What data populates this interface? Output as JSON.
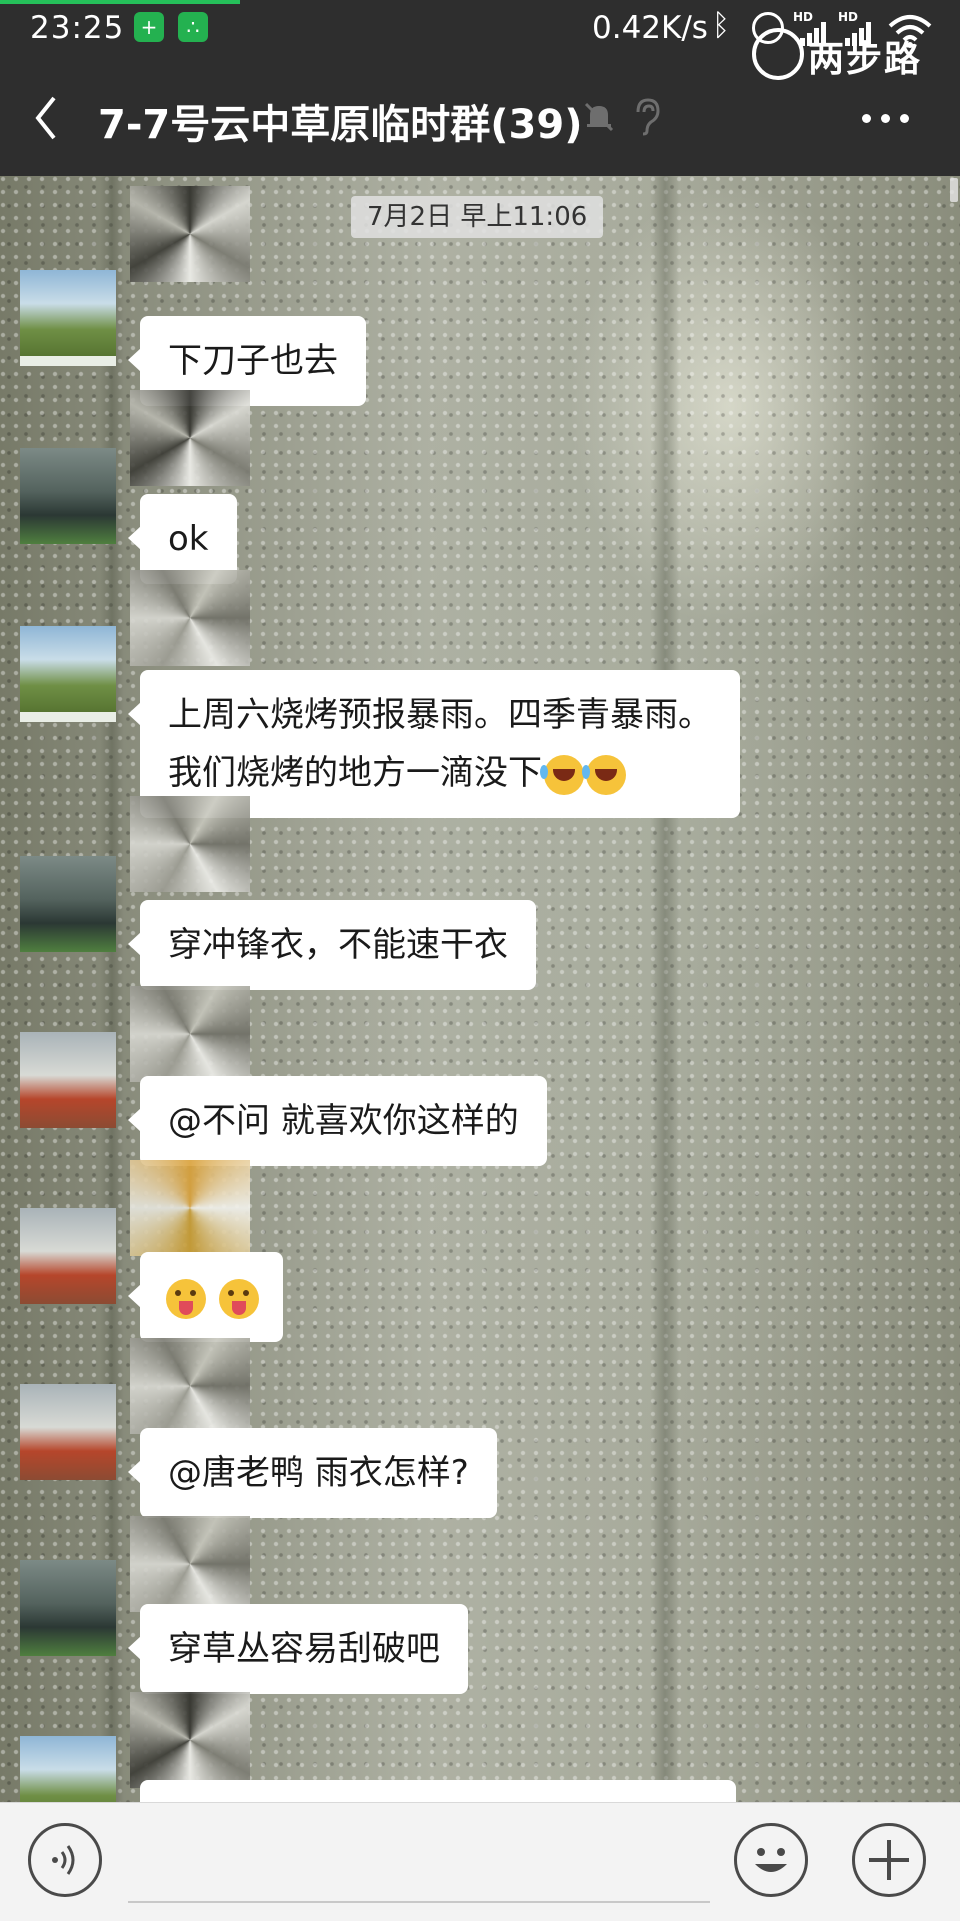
{
  "status_bar": {
    "time": "23:25",
    "net_speed": "0.42K/s",
    "bt_icon": "bluetooth-icon",
    "hd1": "HD",
    "hd2": "HD",
    "progress_color": "#25c05a"
  },
  "watermark": {
    "text": "两步路"
  },
  "header": {
    "title": "7-7号云中草原临时群(39)",
    "back_icon": "chevron-left-icon",
    "mute_icon": "bell-mute-icon",
    "ear_icon": "earpiece-icon",
    "more_icon": "more-dots-icon",
    "bg_color": "#2e2e2e"
  },
  "chat": {
    "date_label": "7月2日 早上11:06",
    "messages": [
      {
        "avatar": "mountain-avatar",
        "text": "下刀子也去"
      },
      {
        "avatar": "diver-avatar",
        "text": "ok"
      },
      {
        "avatar": "mountain-avatar",
        "line1": "上周六烧烤预报暴雨。四季青暴雨。",
        "line2": "我们烧烤的地方一滴没下",
        "emoji": "laughing-crying-emoji"
      },
      {
        "avatar": "diver-avatar",
        "text": "穿冲锋衣，不能速干衣"
      },
      {
        "avatar": "robot-avatar",
        "text": "@不问  就喜欢你这样的"
      },
      {
        "avatar": "robot-avatar",
        "emoji": "winking-tongue-emoji"
      },
      {
        "avatar": "robot-avatar",
        "text": "@唐老鸭  雨衣怎样?"
      },
      {
        "avatar": "diver-avatar",
        "text": "穿草丛容易刮破吧"
      },
      {
        "avatar": "mountain-avatar",
        "text": ""
      }
    ]
  },
  "input_bar": {
    "voice_icon": "voice-icon",
    "emoji_icon": "emoji-face-icon",
    "plus_icon": "plus-icon",
    "input_value": ""
  }
}
